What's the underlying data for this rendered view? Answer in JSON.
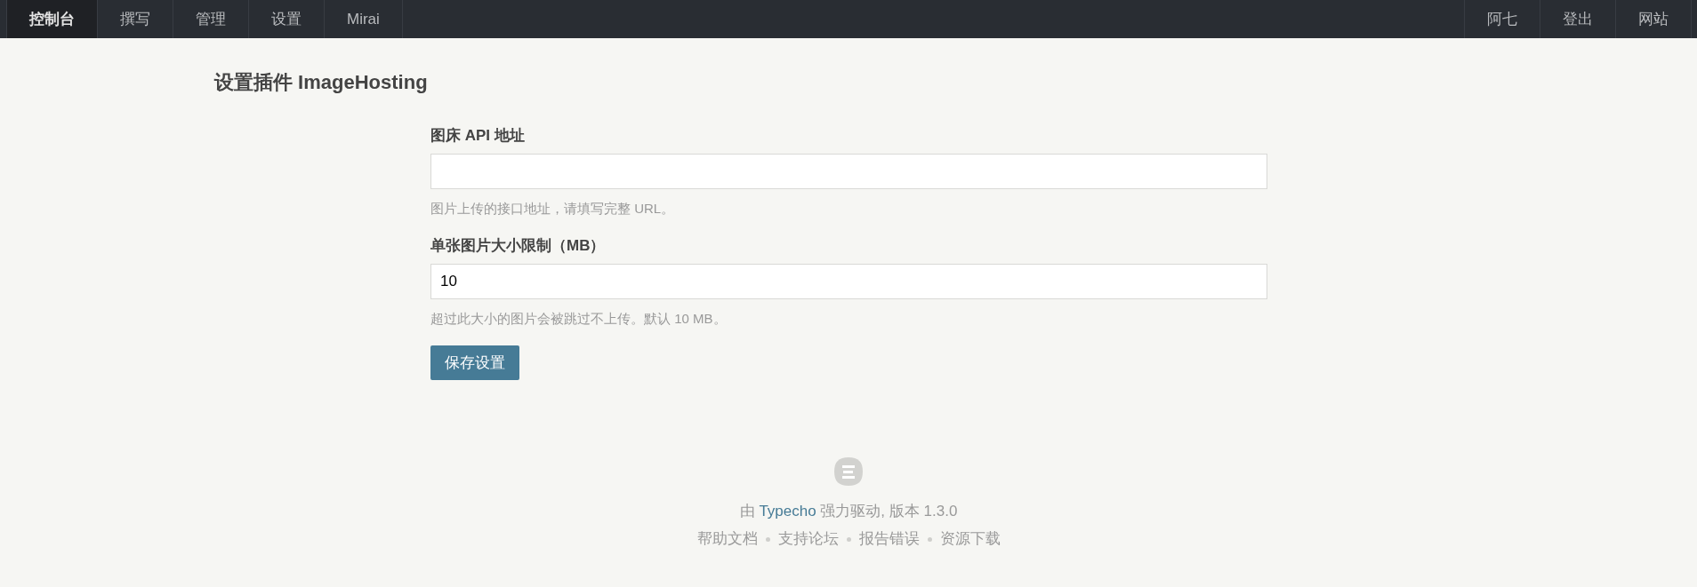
{
  "nav": {
    "left": [
      {
        "label": "控制台",
        "selected": true
      },
      {
        "label": "撰写",
        "selected": false
      },
      {
        "label": "管理",
        "selected": false
      },
      {
        "label": "设置",
        "selected": false
      },
      {
        "label": "Mirai",
        "selected": false
      }
    ],
    "right": [
      {
        "label": "阿七"
      },
      {
        "label": "登出"
      },
      {
        "label": "网站"
      }
    ]
  },
  "page_title": "设置插件 ImageHosting",
  "form": {
    "fields": [
      {
        "label": "图床 API 地址",
        "description": "图片上传的接口地址，请填写完整 URL。"
      },
      {
        "label": "单张图片大小限制（MB）",
        "value": "10",
        "description": "超过此大小的图片会被跳过不上传。默认 10 MB。"
      }
    ],
    "submit": "保存设置"
  },
  "footer": {
    "credit": {
      "before": "由",
      "link": "Typecho",
      "after": "强力驱动, 版本 1.3.0"
    },
    "links": [
      "帮助文档",
      "支持论坛",
      "报告错误",
      "资源下载"
    ]
  }
}
